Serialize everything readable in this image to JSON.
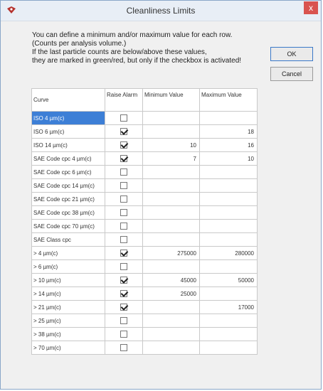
{
  "window": {
    "title": "Cleanliness Limits",
    "close_label": "x",
    "colors": {
      "titlebar": "#e8eef6",
      "close": "#d9534f",
      "selection": "#3d7fd6"
    }
  },
  "description": [
    "You can define a minimum and/or maximum value for each row.",
    "(Counts per analysis volume.)",
    "If the last particle counts are below/above these values,",
    "they are marked in green/red, but only if the checkbox is activated!"
  ],
  "buttons": {
    "ok": "OK",
    "cancel": "Cancel"
  },
  "table": {
    "headers": {
      "curve": "Curve",
      "alarm": "Raise Alarm",
      "min": "Minimum Value",
      "max": "Maximum Value"
    },
    "rows": [
      {
        "curve": "ISO  4 µm(c)",
        "alarm": false,
        "min": "",
        "max": "",
        "selected": true
      },
      {
        "curve": "ISO  6 µm(c)",
        "alarm": true,
        "min": "",
        "max": "18"
      },
      {
        "curve": "ISO 14 µm(c)",
        "alarm": true,
        "min": "10",
        "max": "16"
      },
      {
        "curve": "SAE Code cpc  4 µm(c)",
        "alarm": true,
        "min": "7",
        "max": "10"
      },
      {
        "curve": "SAE Code cpc  6 µm(c)",
        "alarm": false,
        "min": "",
        "max": ""
      },
      {
        "curve": "SAE Code cpc 14 µm(c)",
        "alarm": false,
        "min": "",
        "max": ""
      },
      {
        "curve": "SAE Code cpc 21 µm(c)",
        "alarm": false,
        "min": "",
        "max": ""
      },
      {
        "curve": "SAE Code cpc 38 µm(c)",
        "alarm": false,
        "min": "",
        "max": ""
      },
      {
        "curve": "SAE Code cpc 70 µm(c)",
        "alarm": false,
        "min": "",
        "max": ""
      },
      {
        "curve": "SAE Class cpc",
        "alarm": false,
        "min": "",
        "max": ""
      },
      {
        "curve": "> 4 µm(c)",
        "alarm": true,
        "min": "275000",
        "max": "280000"
      },
      {
        "curve": "> 6 µm(c)",
        "alarm": false,
        "min": "",
        "max": ""
      },
      {
        "curve": "> 10 µm(c)",
        "alarm": true,
        "min": "45000",
        "max": "50000"
      },
      {
        "curve": "> 14 µm(c)",
        "alarm": true,
        "min": "25000",
        "max": ""
      },
      {
        "curve": "> 21 µm(c)",
        "alarm": true,
        "min": "",
        "max": "17000"
      },
      {
        "curve": "> 25 µm(c)",
        "alarm": false,
        "min": "",
        "max": ""
      },
      {
        "curve": "> 38 µm(c)",
        "alarm": false,
        "min": "",
        "max": ""
      },
      {
        "curve": "> 70 µm(c)",
        "alarm": false,
        "min": "",
        "max": ""
      }
    ]
  }
}
